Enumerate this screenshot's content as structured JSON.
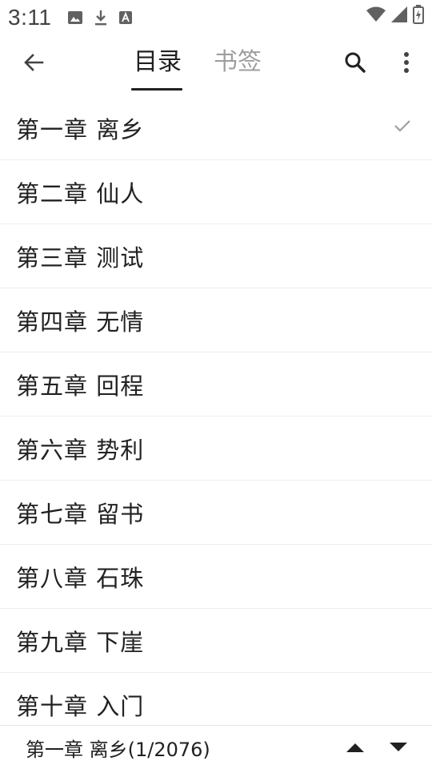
{
  "status_bar": {
    "time": "3:11",
    "icons": [
      "image-icon",
      "download-icon",
      "font-icon",
      "wifi-icon",
      "signal-icon",
      "battery-icon"
    ]
  },
  "toolbar": {
    "back_icon": "arrow-left-icon",
    "tabs": [
      {
        "label": "目录",
        "active": true
      },
      {
        "label": "书签",
        "active": false
      }
    ],
    "search_icon": "search-icon",
    "more_icon": "more-vertical-icon"
  },
  "chapters": [
    {
      "title": "第一章 离乡",
      "current": true
    },
    {
      "title": "第二章 仙人",
      "current": false
    },
    {
      "title": "第三章 测试",
      "current": false
    },
    {
      "title": "第四章 无情",
      "current": false
    },
    {
      "title": "第五章 回程",
      "current": false
    },
    {
      "title": "第六章 势利",
      "current": false
    },
    {
      "title": "第七章 留书",
      "current": false
    },
    {
      "title": "第八章 石珠",
      "current": false
    },
    {
      "title": "第九章 下崖",
      "current": false
    },
    {
      "title": "第十章 入门",
      "current": false
    }
  ],
  "bottom_bar": {
    "current_chapter": "第一章 离乡(1/2076)",
    "up_icon": "triangle-up-icon",
    "down_icon": "triangle-down-icon"
  },
  "colors": {
    "text_primary": "#212121",
    "text_inactive": "#9e9e9e",
    "divider": "#eeeeee",
    "check": "#9e9e9e"
  }
}
